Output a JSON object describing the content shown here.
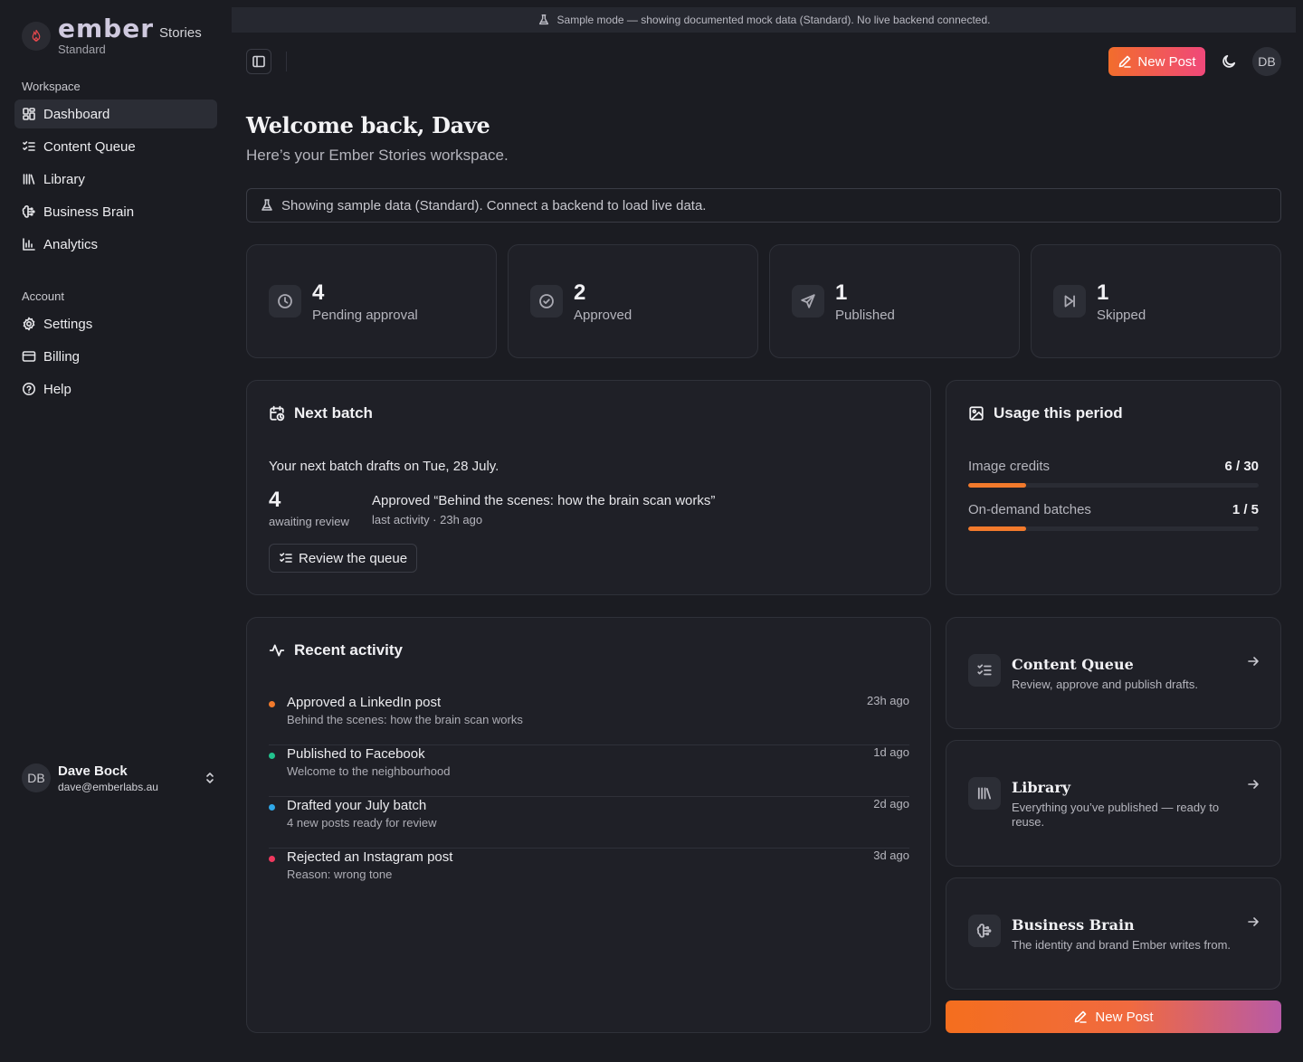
{
  "brand": {
    "name": "ember",
    "product": "Stories",
    "plan": "Standard"
  },
  "sidebar": {
    "workspace_title": "Workspace",
    "workspace_items": [
      {
        "label": "Dashboard",
        "icon": "dashboard-icon",
        "active": true
      },
      {
        "label": "Content Queue",
        "icon": "list-checks-icon"
      },
      {
        "label": "Library",
        "icon": "library-icon"
      },
      {
        "label": "Business Brain",
        "icon": "brain-icon"
      },
      {
        "label": "Analytics",
        "icon": "bar-chart-icon"
      }
    ],
    "account_title": "Account",
    "account_items": [
      {
        "label": "Settings",
        "icon": "gear-icon"
      },
      {
        "label": "Billing",
        "icon": "credit-card-icon"
      },
      {
        "label": "Help",
        "icon": "help-circle-icon"
      }
    ],
    "user": {
      "initials": "DB",
      "name": "Dave Bock",
      "email": "dave@emberlabs.au"
    }
  },
  "banner": {
    "text": "Sample mode — showing documented mock data (Standard). No live backend connected."
  },
  "topbar": {
    "new_post": "New Post",
    "avatar": "DB"
  },
  "header": {
    "title": "Welcome back, Dave",
    "subtitle": "Here’s your Ember Stories workspace."
  },
  "notice": {
    "text": "Showing sample data (Standard). Connect a backend to load live data."
  },
  "stats": [
    {
      "value": "4",
      "label": "Pending approval",
      "icon": "clock-icon"
    },
    {
      "value": "2",
      "label": "Approved",
      "icon": "check-circle-icon"
    },
    {
      "value": "1",
      "label": "Published",
      "icon": "send-icon"
    },
    {
      "value": "1",
      "label": "Skipped",
      "icon": "skip-forward-icon"
    }
  ],
  "next_batch": {
    "title": "Next batch",
    "line": "Your next batch drafts on Tue, 28 July.",
    "count": "4",
    "count_label": "awaiting review",
    "activity": "Approved “Behind the scenes: how the brain scan works”",
    "last_activity": "last activity · 23h ago",
    "button": "Review the queue"
  },
  "usage": {
    "title": "Usage this period",
    "rows": [
      {
        "label": "Image credits",
        "value": "6 / 30",
        "fraction": 0.2
      },
      {
        "label": "On-demand batches",
        "value": "1 / 5",
        "fraction": 0.2
      }
    ]
  },
  "recent": {
    "title": "Recent activity",
    "items": [
      {
        "title": "Approved a LinkedIn post",
        "desc": "Behind the scenes: how the brain scan works",
        "time": "23h ago",
        "color": "#f27a2c"
      },
      {
        "title": "Published to Facebook",
        "desc": "Welcome to the neighbourhood",
        "time": "1d ago",
        "color": "#22c38e"
      },
      {
        "title": "Drafted your July batch",
        "desc": "4 new posts ready for review",
        "time": "2d ago",
        "color": "#2fa8e8"
      },
      {
        "title": "Rejected an Instagram post",
        "desc": "Reason: wrong tone",
        "time": "3d ago",
        "color": "#f0385e"
      }
    ]
  },
  "links": [
    {
      "title": "Content Queue",
      "desc": "Review, approve and publish drafts.",
      "icon": "list-checks-icon"
    },
    {
      "title": "Library",
      "desc": "Everything you’ve published — ready to reuse.",
      "icon": "library-icon"
    },
    {
      "title": "Business Brain",
      "desc": "The identity and brand Ember writes from.",
      "icon": "brain-icon"
    }
  ],
  "bottom": {
    "new_post": "New Post"
  }
}
